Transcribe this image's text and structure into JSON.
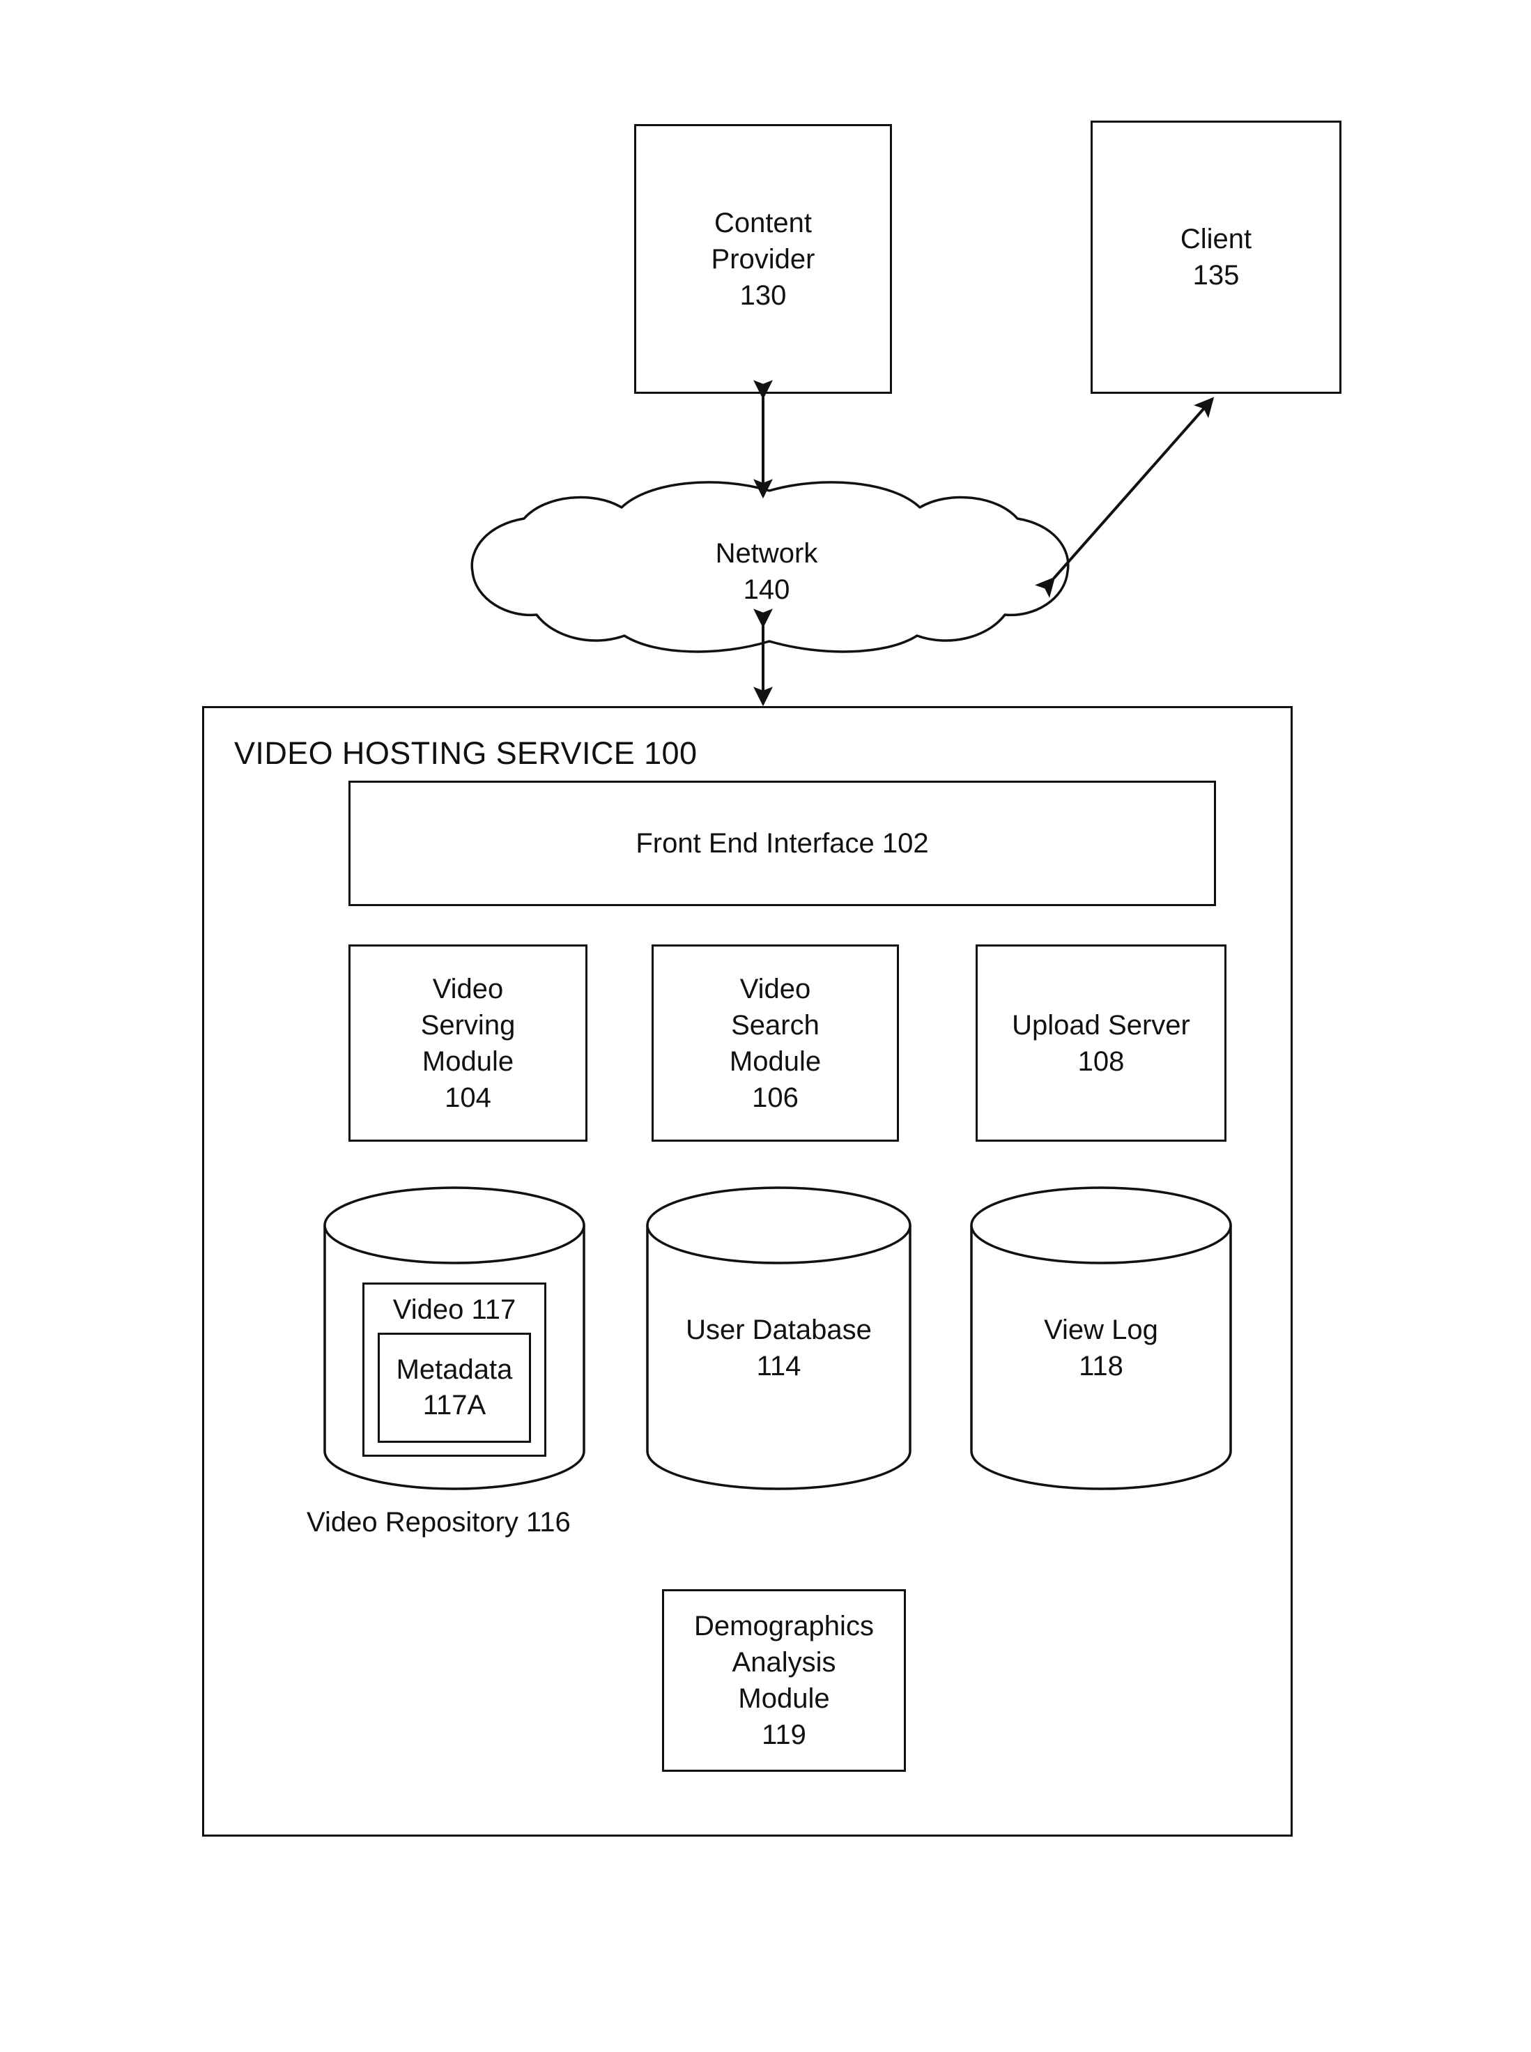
{
  "figure": {
    "top_nodes": [
      {
        "id": "content-provider",
        "lines": [
          "Content",
          "Provider",
          "130"
        ]
      },
      {
        "id": "client",
        "lines": [
          "Client",
          "135"
        ]
      }
    ],
    "network": {
      "lines": [
        "Network",
        "140"
      ]
    },
    "service": {
      "title": "VIDEO HOSTING SERVICE 100",
      "front_end_interface": "Front End Interface 102",
      "modules": [
        {
          "id": "video-serving-module",
          "lines": [
            "Video",
            "Serving",
            "Module",
            "104"
          ]
        },
        {
          "id": "video-search-module",
          "lines": [
            "Video",
            "Search",
            "Module",
            "106"
          ]
        },
        {
          "id": "upload-server",
          "lines": [
            "Upload Server",
            "108"
          ]
        }
      ],
      "stores": [
        {
          "id": "video-repository",
          "caption": "Video Repository 116",
          "inner_box": "Video 117",
          "inner_inner": [
            "Metadata",
            "117A"
          ]
        },
        {
          "id": "user-database",
          "lines": [
            "User Database",
            "114"
          ]
        },
        {
          "id": "view-log",
          "lines": [
            "View Log",
            "118"
          ]
        }
      ],
      "demographics_module": {
        "id": "demographics-analysis-module",
        "lines": [
          "Demographics",
          "Analysis",
          "Module",
          "119"
        ]
      }
    },
    "connectors": [
      {
        "id": "content-provider-to-network",
        "type": "double-arrow",
        "orientation": "vertical"
      },
      {
        "id": "network-to-client",
        "type": "double-arrow",
        "orientation": "diagonal"
      },
      {
        "id": "network-to-service",
        "type": "double-arrow",
        "orientation": "vertical"
      }
    ],
    "colors": {
      "stroke": "#111111",
      "background": "#ffffff"
    }
  }
}
